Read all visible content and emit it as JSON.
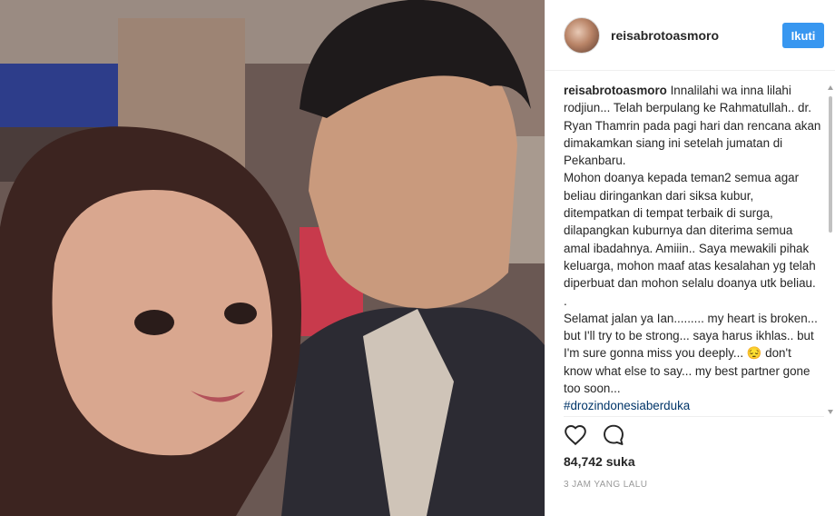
{
  "photo": {
    "description_icon": "photo-icon"
  },
  "header": {
    "username": "reisabrotoasmoro",
    "follow_label": "Ikuti"
  },
  "caption": {
    "username": "reisabrotoasmoro",
    "text": " Innalilahi wa inna lilahi rodjiun... Telah berpulang ke Rahmatullah.. dr. Ryan Thamrin pada pagi hari dan rencana akan dimakamkan siang ini setelah jumatan di Pekanbaru.\nMohon doanya kepada teman2 semua agar beliau diringankan dari siksa kubur, ditempatkan di tempat terbaik di surga, dilapangkan kuburnya dan diterima semua amal ibadahnya. Amiiin.. Saya mewakili pihak keluarga, mohon maaf atas kesalahan yg telah diperbuat dan mohon selalu doanya utk beliau.\n.\nSelamat jalan ya Ian......... my heart is broken... but I'll try to be strong... saya harus ikhlas.. but I'm sure gonna miss you deeply... 😔 don't know what else to say... my best partner gone too soon...",
    "hashtag": "#drozindonesiaberduka"
  },
  "actions": {
    "like_icon": "heart-icon",
    "comment_icon": "comment-icon"
  },
  "likes": {
    "text": "84,742 suka"
  },
  "timestamp": "3 JAM YANG LALU",
  "colors": {
    "accent": "#3897f0",
    "hashtag": "#003569",
    "muted": "#999999",
    "text": "#262626"
  }
}
